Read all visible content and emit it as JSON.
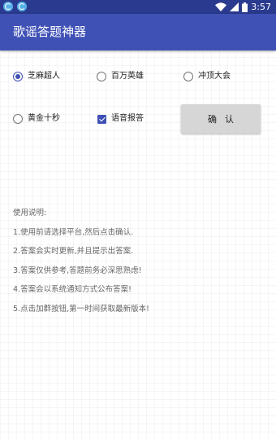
{
  "status_bar": {
    "left_icons": [
      "app-notification-icon",
      "app-notification-icon"
    ],
    "right_icons": [
      "wifi-icon",
      "signal-icon",
      "battery-icon"
    ],
    "time": "3:57"
  },
  "toolbar": {
    "title": "歌谣答题神器"
  },
  "platforms": [
    {
      "label": "芝麻超人",
      "checked": true
    },
    {
      "label": "百万英雄",
      "checked": false
    },
    {
      "label": "冲顶大会",
      "checked": false
    },
    {
      "label": "黄金十秒",
      "checked": false
    }
  ],
  "voice_option": {
    "label": "语音报答",
    "checked": true
  },
  "confirm_button": {
    "label": "确认"
  },
  "instructions": {
    "title": "使用说明:",
    "lines": [
      "1.使用前请选择平台,然后点击确认.",
      "2.答案会实时更新,并且提示出答案.",
      "3.答案仅供参考,答题前务必深思熟虑!",
      "4.答案会以系统通知方式公布答案!",
      "5.点击加群按钮,第一时间获取最新版本!"
    ]
  },
  "colors": {
    "status_bar": "#2a3b8f",
    "toolbar": "#3f51b5",
    "accent": "#3f51b5",
    "button": "#d6d6d6"
  }
}
